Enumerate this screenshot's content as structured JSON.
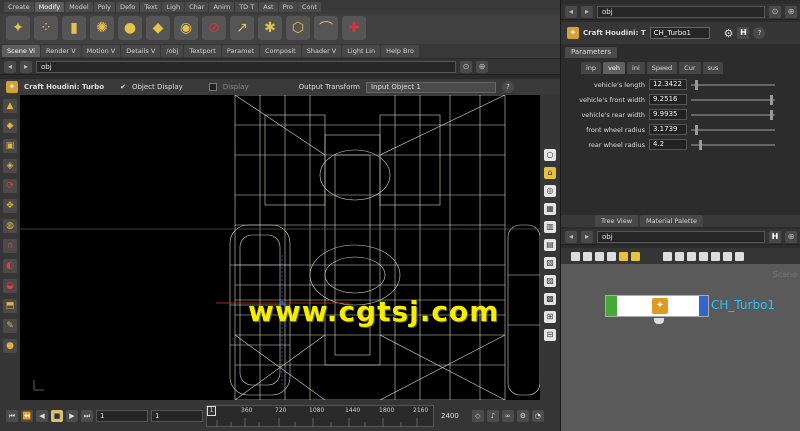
{
  "shelf": {
    "tabs": [
      "Create",
      "Modify",
      "Model",
      "Poly",
      "Defo",
      "Text",
      "Ligh",
      "Char",
      "Anim",
      "TD T",
      "Ast",
      "Pro",
      "Cont"
    ],
    "active_tab_index": 1
  },
  "pane_tabs": [
    "Scene Vi",
    "Render V",
    "Motion V",
    "Details V",
    "/obj",
    "Textport",
    "Paramet",
    "Composit",
    "Shader V",
    "Light Lin",
    "Help Bro"
  ],
  "viewport": {
    "path": "obj",
    "title": "Craft Houdini: Turbo",
    "object_display_label": "Object Display",
    "display_label": "Display",
    "output_transform_label": "Output Transform",
    "output_transform_value": "Input Object 1"
  },
  "watermark": "www.cgtsj.com",
  "timeline": {
    "current_frame": "1",
    "start_frame": "1",
    "ticks": [
      "360",
      "720",
      "1080",
      "1440",
      "1800",
      "2160"
    ],
    "end_frame": "2400",
    "marker_label": "1"
  },
  "parameters": {
    "path": "obj",
    "title": "Craft Houdini: T",
    "node_name": "CH_Turbo1",
    "section_tab": "Parameters",
    "subtabs": [
      "inp",
      "veh",
      "ini",
      "Speed",
      "Cur",
      "sus"
    ],
    "active_subtab_index": 1,
    "rows": [
      {
        "label": "vehicle's length",
        "value": "12.3422",
        "fraction": 0.05
      },
      {
        "label": "vehicle's front width",
        "value": "9.2516",
        "fraction": 0.98
      },
      {
        "label": "vehicle's rear width",
        "value": "9.9935",
        "fraction": 0.98
      },
      {
        "label": "front wheel radius",
        "value": "3.1739",
        "fraction": 0.05
      },
      {
        "label": "rear wheel radius",
        "value": "4.2",
        "fraction": 0.1
      }
    ]
  },
  "network": {
    "tabs": [
      "Tree View",
      "Material Palette"
    ],
    "path": "obj",
    "scene_label": "Scene",
    "node_name": "CH_Turbo1"
  }
}
